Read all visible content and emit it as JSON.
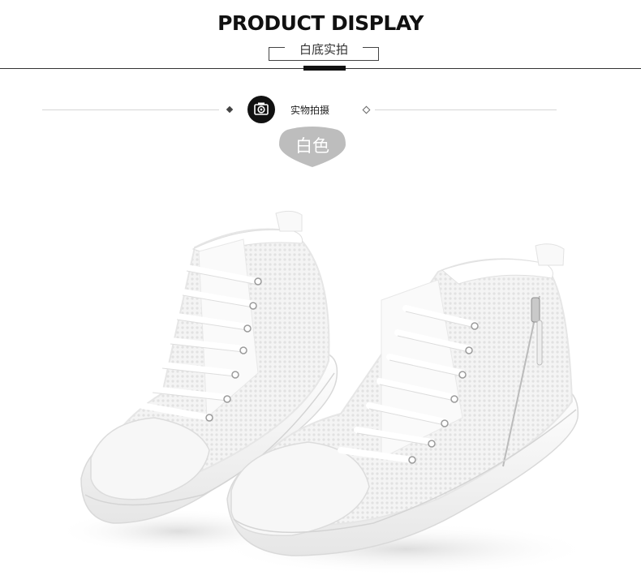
{
  "header": {
    "title": "PRODUCT DISPLAY",
    "subtitle": "白底实拍"
  },
  "section": {
    "label": "实物拍摄",
    "icon": "camera-icon"
  },
  "color_badge": {
    "label": "白色",
    "color": "#bdbdbd"
  },
  "product": {
    "image": "white-mesh-high-top-sneakers-photo"
  }
}
